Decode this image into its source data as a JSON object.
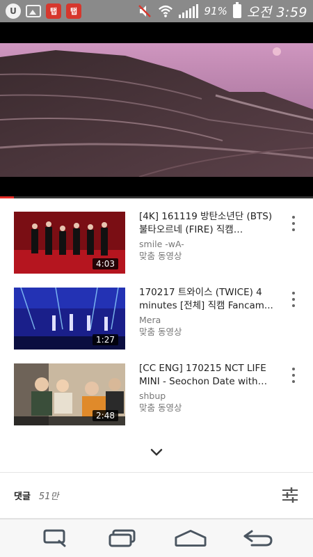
{
  "status_bar": {
    "battery_percent": "91%",
    "time": "오전 3:59",
    "app_icons": [
      "u-app-icon",
      "gallery-icon",
      "red-app-icon",
      "red-app-icon"
    ],
    "red_icon_glyph": "탭"
  },
  "player": {
    "progress": 0.045,
    "accent_color": "#e52d27"
  },
  "videos": [
    {
      "title": "[4K] 161119 방탄소년단 (BTS) 불타오르네 (FIRE) 직캠 @2016...",
      "channel": "smile -wA-",
      "tag": "맞춤 동영상",
      "duration": "4:03"
    },
    {
      "title": "170217 트와이스 (TWICE) 4 minutes [전체] 직캠 Fancam...",
      "channel": "Mera",
      "tag": "맞춤 동영상",
      "duration": "1:27"
    },
    {
      "title": "[CC ENG] 170215 NCT LIFE MINI - Seochon Date with NC...",
      "channel": "shbup",
      "tag": "맞춤 동영상",
      "duration": "2:48"
    }
  ],
  "comments": {
    "label": "댓글",
    "count": "51만"
  },
  "nav": {
    "icons": [
      "search-nav-icon",
      "recents-icon",
      "home-icon",
      "back-icon"
    ]
  }
}
